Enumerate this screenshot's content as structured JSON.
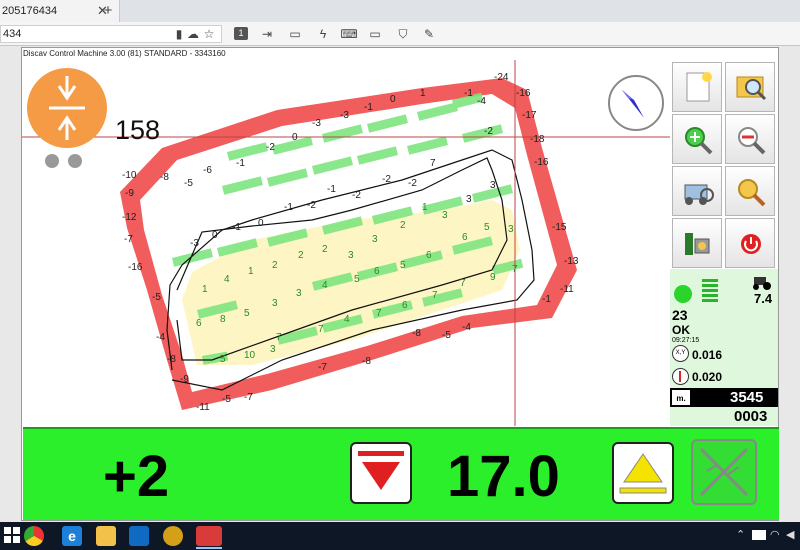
{
  "browser": {
    "tab_title": "205176434",
    "tab_close": "✕",
    "new_tab": "+",
    "address": "434",
    "page_button": "1"
  },
  "app": {
    "title": "Discav Control Machine 3.00 (81) STANDARD - 3343160",
    "counter": "158",
    "map_labels": [
      "-24",
      "-16",
      "-17",
      "-18",
      "-16",
      "-15",
      "-13",
      "-11",
      "-11",
      "-10",
      "-9",
      "-8",
      "-7",
      "-5",
      "-4",
      "-3",
      "-2",
      "-1",
      "0",
      "1",
      "2",
      "3",
      "4",
      "5",
      "6",
      "7",
      "8",
      "9",
      "10",
      "-12"
    ],
    "status": {
      "satellites": "23",
      "quality": "OK",
      "time": "09:27:15",
      "xy_label": "X,Y",
      "xy_value": "0.016",
      "z_value": "0.020",
      "signal": "7.4",
      "m_label": "m.",
      "distance": "3545",
      "count": "0003"
    },
    "bottom": {
      "offset": "+2",
      "value": "17.0"
    }
  },
  "colors": {
    "bar_green": "#2bef2b",
    "tool_orange": "#f59a45",
    "map_red": "#ef4040",
    "map_green": "#7fe57f",
    "map_yellow": "#fdf6c4"
  }
}
